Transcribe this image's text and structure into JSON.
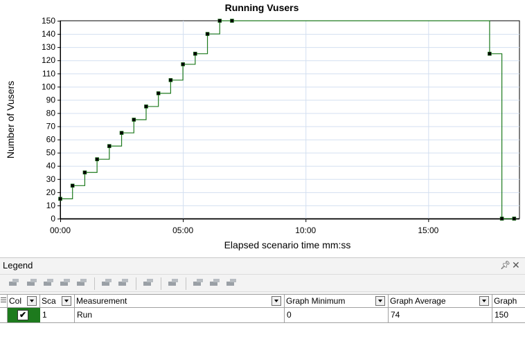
{
  "chart_data": {
    "type": "line",
    "step": true,
    "title": "Running Vusers",
    "xlabel": "Elapsed scenario time mm:ss",
    "ylabel": "Number of Vusers",
    "ylim": [
      0,
      150
    ],
    "yticks": [
      0,
      10,
      20,
      30,
      40,
      50,
      60,
      70,
      80,
      90,
      100,
      110,
      120,
      130,
      140,
      150
    ],
    "xlim_seconds": [
      0,
      1123
    ],
    "xticks": [
      {
        "seconds": 0,
        "label": "00:00"
      },
      {
        "seconds": 300,
        "label": "05:00"
      },
      {
        "seconds": 600,
        "label": "10:00"
      },
      {
        "seconds": 900,
        "label": "15:00"
      }
    ],
    "grid": true,
    "series": [
      {
        "name": "Run",
        "color": "#1d7a1d",
        "x_seconds": [
          0,
          30,
          60,
          90,
          120,
          150,
          180,
          210,
          240,
          270,
          300,
          330,
          360,
          390,
          420,
          1050,
          1080,
          1110
        ],
        "values": [
          15,
          25,
          35,
          45,
          55,
          65,
          75,
          85,
          95,
          105,
          117,
          125,
          140,
          150,
          150,
          125,
          0,
          0
        ]
      }
    ]
  },
  "legend": {
    "title": "Legend",
    "pin_icon": "pin-icon",
    "close_icon": "close-icon",
    "columns": {
      "color": "Col",
      "scale": "Sca",
      "measurement": "Measurement",
      "graph_minimum": "Graph Minimum",
      "graph_average": "Graph Average",
      "graph_maximum": "Graph"
    },
    "rows": [
      {
        "checked": "✔",
        "scale": "1",
        "measurement": "Run",
        "graph_minimum": "0",
        "graph_average": "74",
        "graph_maximum": "150"
      }
    ]
  }
}
